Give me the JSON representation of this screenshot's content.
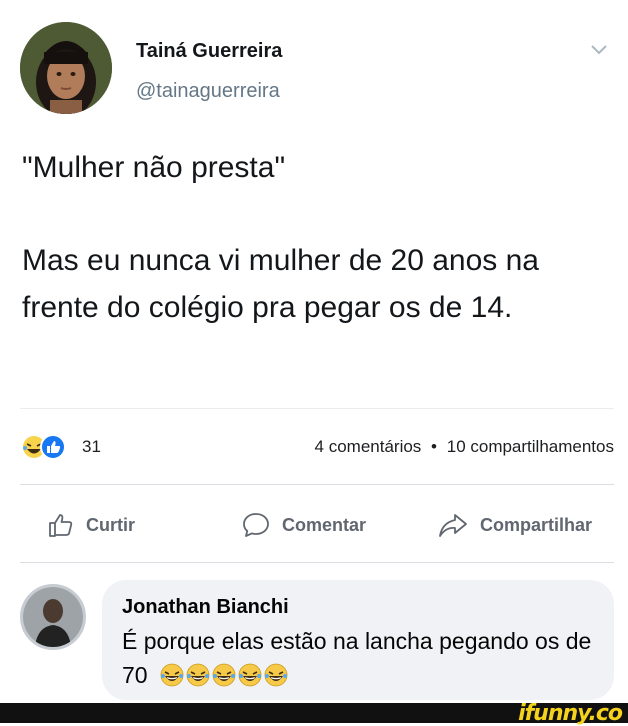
{
  "post": {
    "author_name": "Tainá Guerreira",
    "author_handle": "@tainaguerreira",
    "menu_icon": "chevron-down-icon",
    "text_quote": "\"Mulher não presta\"",
    "text_body": "Mas eu nunca vi mulher de 20 anos na frente do colégio pra pegar os de 14."
  },
  "stats": {
    "reaction_icons": [
      "laughing-emoji-icon",
      "like-icon"
    ],
    "reaction_count": "31",
    "comments": "4 comentários",
    "separator": "•",
    "shares": "10 compartilhamentos"
  },
  "actions": {
    "like_label": "Curtir",
    "comment_label": "Comentar",
    "share_label": "Compartilhar"
  },
  "comment": {
    "author": "Jonathan Bianchi",
    "text": "É porque elas estão na lancha pegando os de 70",
    "emoji_count": 5
  },
  "watermark": {
    "text": "ifunny.co",
    "color": "#f5d21b"
  },
  "colors": {
    "text": "#14171a",
    "muted": "#606770",
    "bubble": "#f0f2f5",
    "like_blue": "#1877f2"
  }
}
